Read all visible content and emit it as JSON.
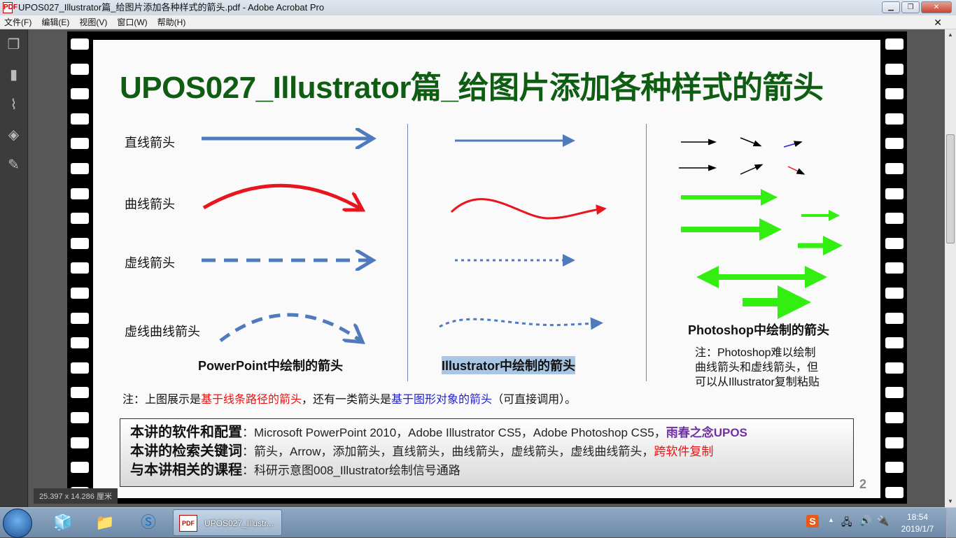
{
  "window": {
    "title": "UPOS027_Illustrator篇_给图片添加各种样式的箭头.pdf - Adobe Acrobat Pro",
    "pdf_icon": "PDF"
  },
  "menu": [
    "文件(F)",
    "编辑(E)",
    "视图(V)",
    "窗口(W)",
    "帮助(H)"
  ],
  "slide": {
    "title": "UPOS027_Illustrator篇_给图片添加各种样式的箭头",
    "row_labels": [
      "直线箭头",
      "曲线箭头",
      "虚线箭头",
      "虚线曲线箭头"
    ],
    "col_captions": [
      "PowerPoint中绘制的箭头",
      "Illustrator中绘制的箭头",
      "Photoshop中绘制的箭头"
    ],
    "ps_note": [
      "注：Photoshop难以绘制",
      "曲线箭头和虚线箭头，但",
      "可以从Illustrator复制粘贴"
    ],
    "note": {
      "p1": "注：上图展示是",
      "p2": "基于线条路径的箭头",
      "p3": "，还有一类箭头是",
      "p4": "基于图形对象的箭头",
      "p5": "（可直接调用）。"
    },
    "info": {
      "l1_label": "本讲的软件和配置",
      "l1_text": "：Microsoft PowerPoint 2010，Adobe Illustrator CS5，Adobe Photoshop CS5，",
      "l1_brand": "雨春之念UPOS",
      "l2_label": "本讲的检索关键词",
      "l2_text": "：箭头，Arrow，添加箭头，直线箭头，曲线箭头，虚线箭头，虚线曲线箭头，",
      "l2_red": "跨软件复制",
      "l3_label": "与本讲相关的课程",
      "l3_text": "：科研示意图008_Illustrator绘制信号通路"
    },
    "page_number": "2"
  },
  "status": {
    "dimensions": "25.397 x 14.286 厘米"
  },
  "taskbar": {
    "item_label": "UPOS027_Illustr...",
    "item_icon": "PDF",
    "time": "18:54",
    "date": "2019/1/7",
    "ime": "S"
  },
  "colors": {
    "title_green": "#0f5d12",
    "ppt_blue": "#4f7bbd",
    "red": "#e8141e",
    "green": "#33ee11"
  }
}
